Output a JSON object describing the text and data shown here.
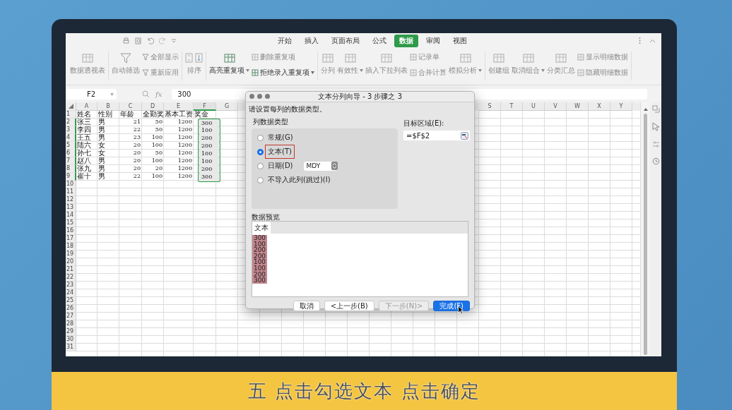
{
  "menu_tabs": [
    {
      "label": "开始",
      "selected": false
    },
    {
      "label": "插入",
      "selected": false
    },
    {
      "label": "页面布局",
      "selected": false
    },
    {
      "label": "公式",
      "selected": false
    },
    {
      "label": "数据",
      "selected": true
    },
    {
      "label": "审阅",
      "selected": false
    },
    {
      "label": "视图",
      "selected": false
    }
  ],
  "ribbon_groups": [
    {
      "columns": [
        {
          "kind": "big",
          "label": "数据透视表",
          "disabled": true,
          "dropdown": false
        }
      ]
    },
    {
      "columns": [
        {
          "kind": "big",
          "label": "自动筛选",
          "disabled": true,
          "dropdown": false
        },
        {
          "kind": "stack",
          "items": [
            {
              "label": "全部显示",
              "disabled": true,
              "dropdown": false
            },
            {
              "label": "重新应用",
              "disabled": true,
              "dropdown": false
            }
          ]
        }
      ]
    },
    {
      "columns": [
        {
          "kind": "sort",
          "label": "排序",
          "disabled": true,
          "dropdown": false
        }
      ]
    },
    {
      "columns": [
        {
          "kind": "big",
          "label": "高亮重复项",
          "disabled": false,
          "dropdown": true
        },
        {
          "kind": "stack",
          "items": [
            {
              "label": "删除重复项",
              "disabled": true,
              "dropdown": false
            },
            {
              "label": "拒绝录入重复项",
              "disabled": false,
              "dropdown": true
            }
          ]
        }
      ]
    },
    {
      "columns": [
        {
          "kind": "big",
          "label": "分列",
          "disabled": true,
          "dropdown": false
        },
        {
          "kind": "big",
          "label": "有效性",
          "disabled": true,
          "dropdown": true
        },
        {
          "kind": "big",
          "label": "插入下拉列表",
          "disabled": true,
          "dropdown": false
        },
        {
          "kind": "stack",
          "items": [
            {
              "label": "记录单",
              "disabled": true,
              "dropdown": false
            },
            {
              "label": "合并计算",
              "disabled": true,
              "dropdown": false
            }
          ]
        },
        {
          "kind": "big",
          "label": "模拟分析",
          "disabled": true,
          "dropdown": true
        }
      ]
    },
    {
      "columns": [
        {
          "kind": "big",
          "label": "创建组",
          "disabled": true,
          "dropdown": false
        },
        {
          "kind": "big",
          "label": "取消组合",
          "disabled": true,
          "dropdown": true
        },
        {
          "kind": "big",
          "label": "分类汇总",
          "disabled": true,
          "dropdown": false
        },
        {
          "kind": "stack",
          "items": [
            {
              "label": "显示明细数据",
              "disabled": true,
              "dropdown": false
            },
            {
              "label": "隐藏明细数据",
              "disabled": true,
              "dropdown": false
            }
          ]
        }
      ]
    }
  ],
  "formula_bar": {
    "name_box": "F2",
    "fx": "fx",
    "value": "300"
  },
  "sheet": {
    "columns_left": [
      {
        "label": "A",
        "selected": false,
        "numeric": false
      },
      {
        "label": "B",
        "selected": false,
        "numeric": false
      },
      {
        "label": "C",
        "selected": false,
        "numeric": true
      },
      {
        "label": "D",
        "selected": false,
        "numeric": true
      },
      {
        "label": "E",
        "selected": false,
        "numeric": true
      },
      {
        "label": "F",
        "selected": true,
        "numeric": true
      },
      {
        "label": "G",
        "selected": false
      }
    ],
    "columns_right": [
      {
        "label": "S",
        "selected": false
      },
      {
        "label": "T",
        "selected": false
      },
      {
        "label": "U",
        "selected": false
      },
      {
        "label": "V",
        "selected": false
      },
      {
        "label": "W",
        "selected": false
      },
      {
        "label": "X",
        "selected": false
      },
      {
        "label": "Y",
        "selected": false
      }
    ],
    "rows": [
      {
        "number": "1",
        "selected": false,
        "kind": "header",
        "cells": [
          "姓名",
          "性别",
          "年龄",
          "全勤奖",
          "基本工资",
          "奖金"
        ]
      },
      {
        "number": "2",
        "selected": true,
        "kind": "data",
        "cells": [
          "张三",
          "男",
          "21",
          "50",
          "1200",
          "300"
        ]
      },
      {
        "number": "3",
        "selected": true,
        "kind": "data",
        "cells": [
          "李四",
          "男",
          "22",
          "50",
          "1200",
          "100"
        ]
      },
      {
        "number": "4",
        "selected": true,
        "kind": "data",
        "cells": [
          "王五",
          "男",
          "23",
          "100",
          "1200",
          "200"
        ]
      },
      {
        "number": "5",
        "selected": true,
        "kind": "data",
        "cells": [
          "陆六",
          "女",
          "20",
          "100",
          "1200",
          "200"
        ]
      },
      {
        "number": "6",
        "selected": true,
        "kind": "data",
        "cells": [
          "孙七",
          "女",
          "20",
          "50",
          "1200",
          "100"
        ]
      },
      {
        "number": "7",
        "selected": true,
        "kind": "data",
        "cells": [
          "赵八",
          "男",
          "20",
          "100",
          "1200",
          "100"
        ]
      },
      {
        "number": "8",
        "selected": true,
        "kind": "data",
        "cells": [
          "张九",
          "男",
          "20",
          "20",
          "1200",
          "200"
        ]
      },
      {
        "number": "9",
        "selected": true,
        "kind": "data",
        "cells": [
          "崔十",
          "男",
          "22",
          "100",
          "1200",
          "300"
        ]
      },
      {
        "number": "10",
        "selected": false
      },
      {
        "number": "11",
        "selected": false
      },
      {
        "number": "12",
        "selected": false
      },
      {
        "number": "13",
        "selected": false
      },
      {
        "number": "14",
        "selected": false
      },
      {
        "number": "15",
        "selected": false
      },
      {
        "number": "16",
        "selected": false
      },
      {
        "number": "17",
        "selected": false
      },
      {
        "number": "18",
        "selected": false
      },
      {
        "number": "19",
        "selected": false
      },
      {
        "number": "20",
        "selected": false
      },
      {
        "number": "21",
        "selected": false
      },
      {
        "number": "22",
        "selected": false
      },
      {
        "number": "23",
        "selected": false
      },
      {
        "number": "24",
        "selected": false
      },
      {
        "number": "25",
        "selected": false
      },
      {
        "number": "26",
        "selected": false
      },
      {
        "number": "27",
        "selected": false
      },
      {
        "number": "28",
        "selected": false
      },
      {
        "number": "29",
        "selected": false
      },
      {
        "number": "30",
        "selected": false
      },
      {
        "number": "31",
        "selected": false
      }
    ]
  },
  "dialog": {
    "title": "文本分列向导 - 3 步骤之 3",
    "instruction": "请设置每列的数据类型。",
    "type_group": {
      "label": "列数据类型",
      "options": [
        {
          "label": "常规(G)",
          "selected": false,
          "highlighted": false
        },
        {
          "label": "文本(T)",
          "selected": true,
          "highlighted": true
        },
        {
          "label": "日期(D)",
          "selected": false,
          "highlighted": false,
          "format": "MDY"
        },
        {
          "label": "不导入此列(跳过)(I)",
          "selected": false,
          "highlighted": false
        }
      ]
    },
    "destination": {
      "label": "目标区域(E):",
      "value": "=$F$2"
    },
    "preview": {
      "label": "数据预览",
      "header": "文本",
      "values": [
        "300",
        "100",
        "200",
        "200",
        "100",
        "100",
        "200",
        "300"
      ]
    },
    "buttons": [
      {
        "label": "取消",
        "kind": "normal"
      },
      {
        "label": "<上一步(B)",
        "kind": "normal"
      },
      {
        "label": "下一步(N)>",
        "kind": "disabled"
      },
      {
        "label": "完成(F)",
        "kind": "primary"
      }
    ]
  },
  "caption": "五 点击勾选文本 点击确定"
}
